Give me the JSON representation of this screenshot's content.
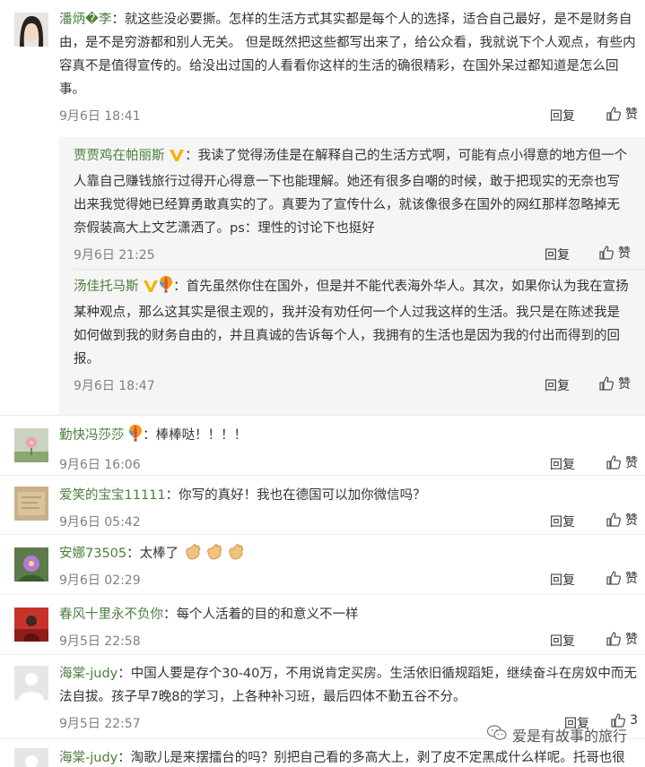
{
  "comments": [
    {
      "user": "潘炳�李",
      "text": "就这些没必要撕。怎样的生活方式其实都是每个人的选择，适合自己最好，是不是财务自由，是不是穷游都和别人无关。 但是既然把这些都写出来了，给公众看，我就说下个人观点，有些内容真不是值得宣传的。给没出过国的人看看你这样的生活的确很精彩，在国外呆过都知道是怎么回事。",
      "time": "9月6日 18:41",
      "reply": "回复",
      "like": "赞"
    },
    {
      "user": "勤快冯莎莎",
      "text": "棒棒哒！！！！",
      "time": "9月6日 16:06",
      "reply": "回复",
      "like": "赞"
    },
    {
      "user": "爱笑的宝宝11111",
      "text": "你写的真好！我也在德国可以加你微信吗？",
      "time": "9月6日 05:42",
      "reply": "回复",
      "like": "赞"
    },
    {
      "user": "安娜73505",
      "text": "太棒了",
      "time": "9月6日 02:29",
      "reply": "回复",
      "like": "赞"
    },
    {
      "user": "春风十里永不负你",
      "text": "每个人活着的目的和意义不一样",
      "time": "9月5日 22:58",
      "reply": "回复",
      "like": "赞"
    },
    {
      "user": "海棠-judy",
      "text": "中国人要是存个30-40万，不用说肯定买房。生活依旧循规蹈矩，继续奋斗在房奴中而无法自拔。孩子早7晚8的学习，上各种补习班，最后四体不勤五谷不分。",
      "time": "9月5日 22:57",
      "reply": "回复",
      "like": "3"
    },
    {
      "user": "海棠-judy",
      "text": "淘歌儿是来摆擂台的吗？别把自己看的多高大上，剥了皮不定黑成什么样呢。托哥也很"
    }
  ],
  "subs": [
    {
      "user": "贾贾鸡在帕丽斯",
      "text": "我读了觉得汤佳是在解释自己的生活方式啊，可能有点小得意的地方但一个人靠自己赚钱旅行过得开心得意一下也能理解。她还有很多自嘲的时候，敢于把现实的无奈也写出来我觉得她已经算勇敢真实的了。真要为了宣传什么，就该像很多在国外的网红那样忽略掉无奈假装高大上文艺潇洒了。ps：理性的讨论下也挺好",
      "time": "9月6日 21:25",
      "reply": "回复",
      "like": "赞"
    },
    {
      "user": "汤佳托马斯",
      "text": "首先虽然你住在国外，但是并不能代表海外华人。其次，如果你认为我在宣扬某种观点，那么这其实是很主观的，我并没有劝任何一个人过我这样的生活。我只是在陈述我是如何做到我的财务自由的，并且真诚的告诉每个人，我拥有的生活也是因为我的付出而得到的回报。",
      "time": "9月6日 18:47",
      "reply": "回复",
      "like": "赞"
    }
  ],
  "sep": "：",
  "watermark": "爱是有故事的旅行",
  "colors": {
    "username": "#4a7e3d",
    "time": "#808080",
    "reply_bg": "#f5f5f5"
  }
}
